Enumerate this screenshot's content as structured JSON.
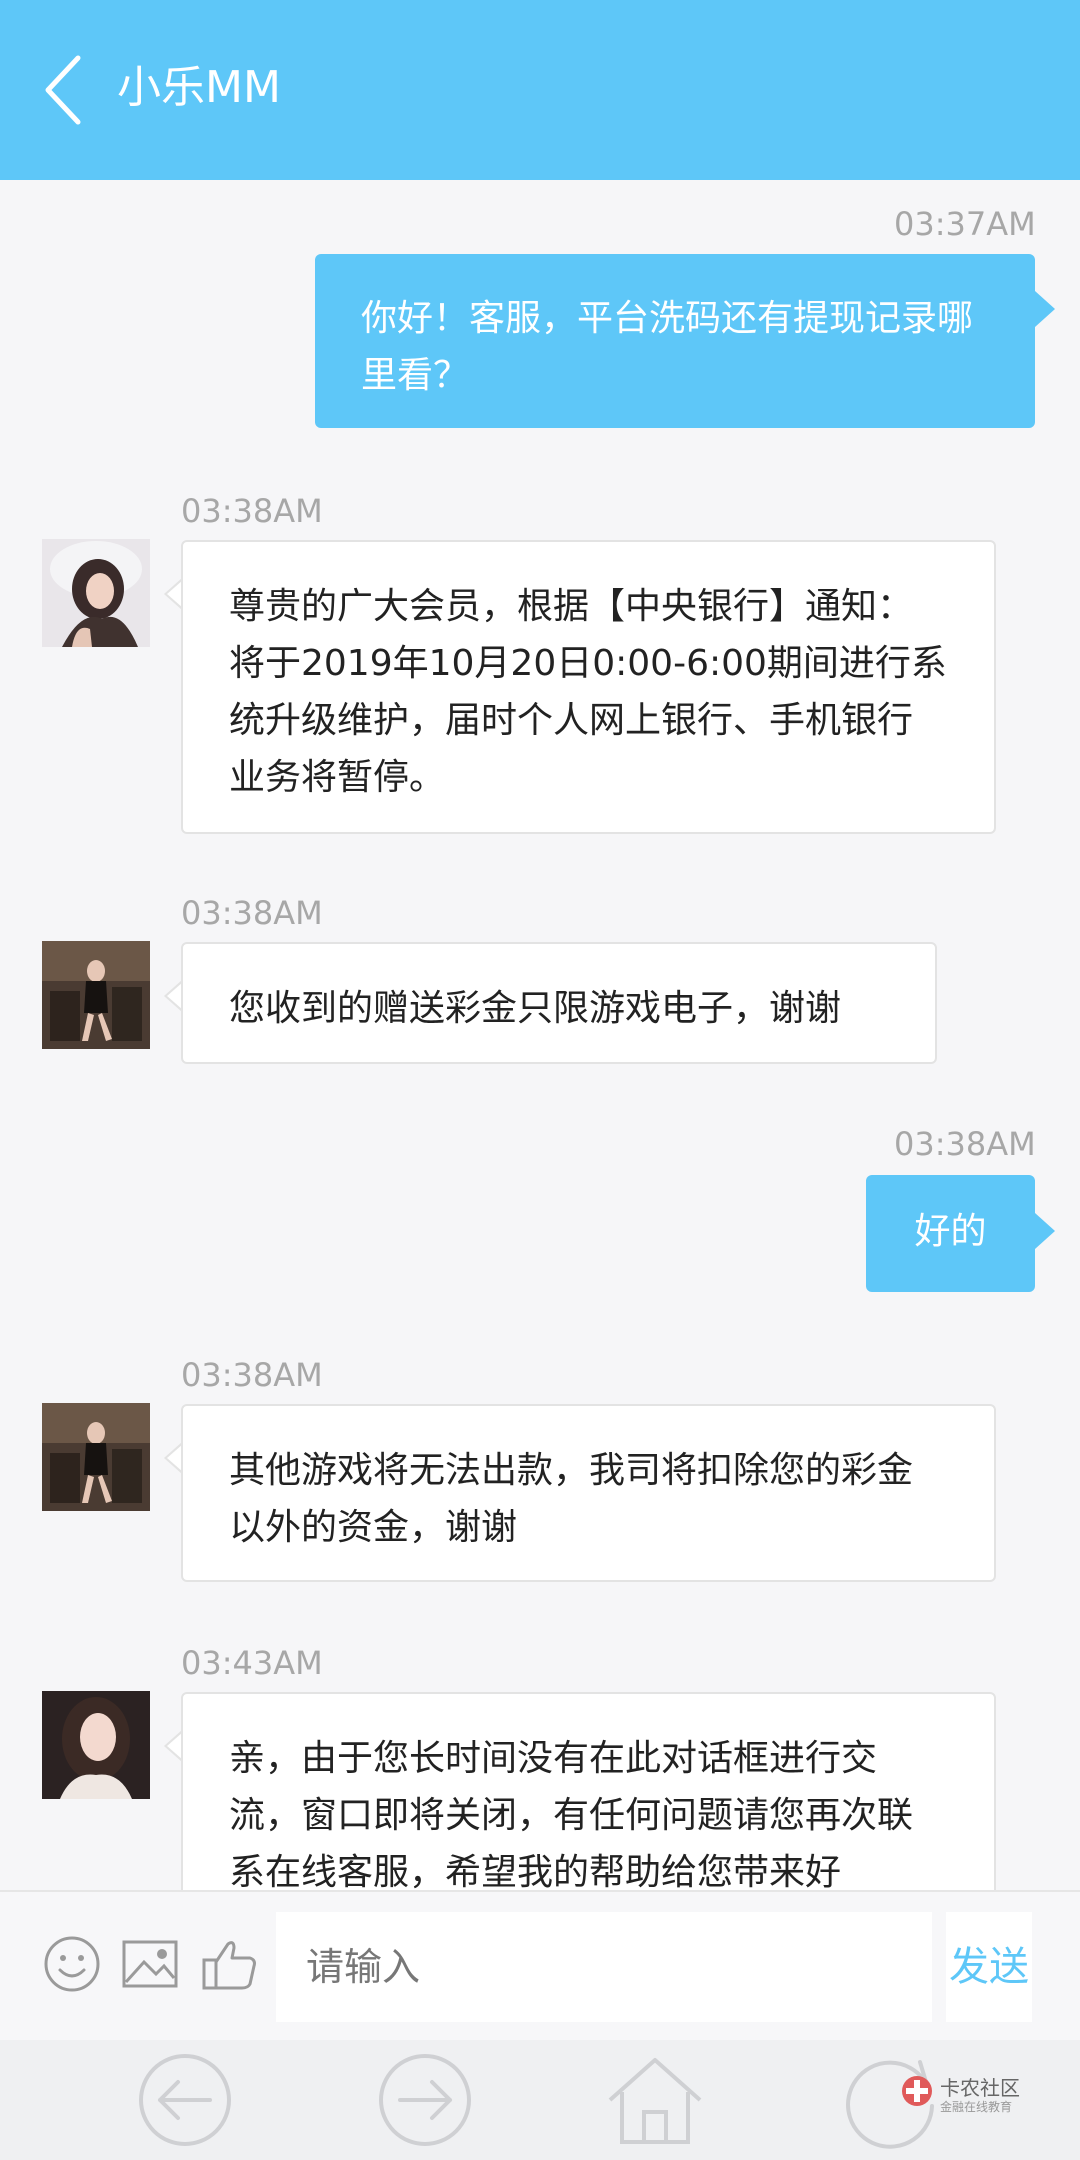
{
  "header": {
    "title": "小乐MM"
  },
  "messages": [
    {
      "time": "03:37AM",
      "text": "你好！客服，平台洗码还有提现记录哪里看？"
    },
    {
      "time": "03:38AM",
      "text": "尊贵的广大会员，根据【中央银行】通知：将于2019年10月20日0:00-6:00期间进行系统升级维护，届时个人网上银行、手机银行业务将暂停。"
    },
    {
      "time": "03:38AM",
      "text": "您收到的赠送彩金只限游戏电子，谢谢"
    },
    {
      "time": "03:38AM",
      "text": "好的"
    },
    {
      "time": "03:38AM",
      "text": "其他游戏将无法出款，我司将扣除您的彩金以外的资金，谢谢"
    },
    {
      "time": "03:43AM",
      "text": "亲，由于您长时间没有在此对话框进行交流，窗口即将关闭，有任何问题请您再次联系在线客服，希望我的帮助给您带来好"
    }
  ],
  "input": {
    "placeholder": "请输入",
    "value": ""
  },
  "send_label": "发送",
  "watermark": {
    "title": "卡农社区",
    "subtitle": "金融在线教育"
  },
  "colors": {
    "accent": "#5ec7f8",
    "background": "#f6f6f8"
  }
}
